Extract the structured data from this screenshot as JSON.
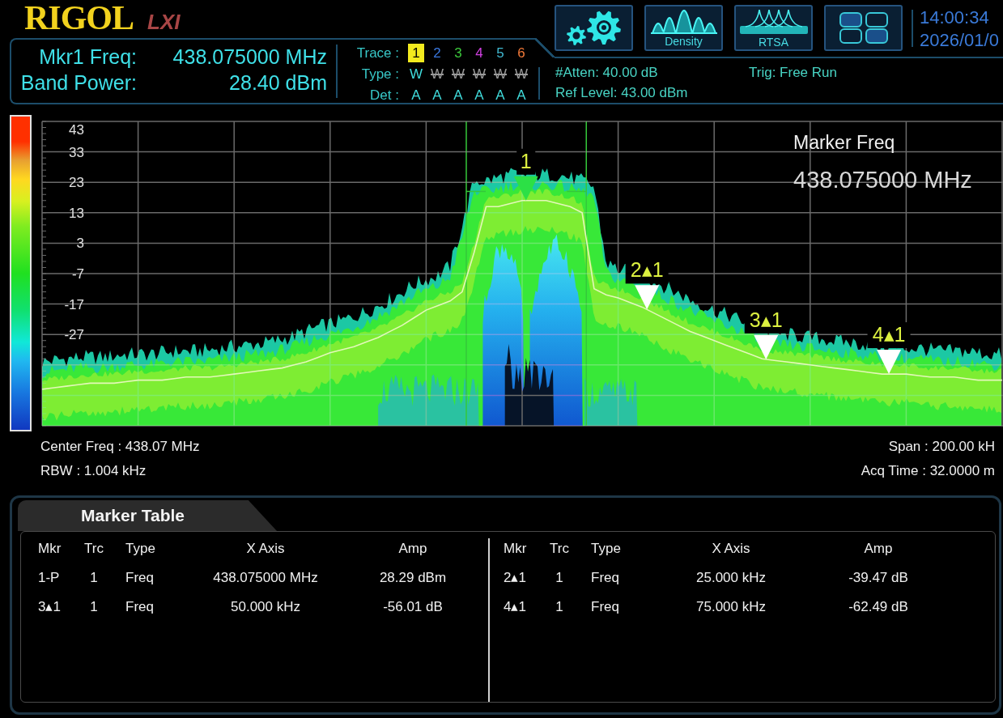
{
  "header": {
    "logo": {
      "brand": "RIGOL",
      "badge": "LXI"
    },
    "readouts": [
      {
        "label": "Mkr1 Freq:",
        "value": "438.075000 MHz"
      },
      {
        "label": "Band Power:",
        "value": "28.40 dBm"
      }
    ],
    "trace_table": {
      "trace_label": "Trace :",
      "type_label": "Type :",
      "det_label": "Det :",
      "traces": [
        {
          "number": "1",
          "color": "#f2ea1e",
          "selected": true,
          "type": "W",
          "on": true,
          "detector": "A"
        },
        {
          "number": "2",
          "color": "#3a78e0",
          "selected": false,
          "type": "W",
          "on": false,
          "detector": "A"
        },
        {
          "number": "3",
          "color": "#3cc83c",
          "selected": false,
          "type": "W",
          "on": false,
          "detector": "A"
        },
        {
          "number": "4",
          "color": "#d040e0",
          "selected": false,
          "type": "W",
          "on": false,
          "detector": "A"
        },
        {
          "number": "5",
          "color": "#40b8d0",
          "selected": false,
          "type": "W",
          "on": false,
          "detector": "A"
        },
        {
          "number": "6",
          "color": "#f07838",
          "selected": false,
          "type": "W",
          "on": false,
          "detector": "A"
        }
      ]
    },
    "mode_buttons": [
      {
        "kind": "settings"
      },
      {
        "kind": "density",
        "label": "Density"
      },
      {
        "kind": "rtsa",
        "label": "RTSA"
      },
      {
        "kind": "layout"
      }
    ],
    "clock": {
      "time": "14:00:34",
      "date": "2026/01/0"
    },
    "status": {
      "attenuation": "#Atten: 40.00 dB",
      "ref_level": "Ref Level: 43.00 dBm",
      "trigger": "Trig: Free Run"
    }
  },
  "spectrum": {
    "marker_readout": {
      "label": "Marker Freq",
      "value": "438.075000 MHz"
    },
    "markers": [
      {
        "label": "1",
        "color": "#2ce046"
      },
      {
        "label": "2▴1",
        "color": "#ffffff"
      },
      {
        "label": "3▴1",
        "color": "#ffffff"
      },
      {
        "label": "4▴1",
        "color": "#ffffff"
      }
    ],
    "chart_data": {
      "type": "line",
      "categories": [
        null,
        null,
        null,
        null,
        null,
        null,
        null,
        null,
        null,
        null,
        null,
        null,
        null,
        null,
        null,
        null,
        null,
        null,
        null,
        null,
        null,
        null,
        null,
        null,
        null,
        null,
        null,
        null,
        null,
        null,
        null,
        null,
        null,
        null,
        null,
        null,
        null,
        null,
        null,
        null,
        null,
        null,
        null,
        null,
        null,
        null,
        null,
        null,
        null,
        null,
        null,
        null,
        null,
        null,
        null,
        null,
        null,
        null,
        null,
        null,
        null,
        null,
        null,
        null,
        null,
        null,
        null,
        null,
        null,
        null,
        null,
        null,
        null,
        null,
        null,
        null,
        null,
        null,
        null,
        null,
        null
      ],
      "ylim": [
        -57,
        43
      ],
      "yticks": [
        43,
        33,
        23,
        13,
        3,
        -7,
        -17,
        -27
      ],
      "grid": true,
      "series": [
        {
          "color": "#eef8c8",
          "values": [
            -45,
            -44.5,
            -44,
            -43.5,
            -43,
            -43,
            -43,
            -42.5,
            -42,
            -42,
            -42,
            -41.5,
            -41,
            -41,
            -41,
            -40.5,
            -40,
            -39.5,
            -39,
            -38.5,
            -38,
            -37,
            -36,
            -34.5,
            -33,
            -32,
            -31,
            -29.5,
            -28,
            -26,
            -24,
            -21.5,
            -19,
            -17.5,
            -16,
            -13,
            0,
            15,
            15,
            16,
            17,
            17,
            17,
            16,
            15,
            13,
            -12,
            -14,
            -15,
            -16.5,
            -18,
            -20,
            -22,
            -24,
            -26,
            -27.5,
            -29,
            -30.5,
            -32,
            -33.5,
            -35,
            -35.5,
            -36,
            -36.5,
            -37,
            -37.5,
            -38,
            -38.5,
            -39,
            -39.5,
            -40,
            -40,
            -40,
            -40.5,
            -41,
            -41,
            -41,
            -41.5,
            -42,
            -42,
            -42
          ]
        }
      ]
    }
  },
  "sweep_info": {
    "center_freq": "Center Freq : 438.07 MHz",
    "rbw": "RBW : 1.004 kHz",
    "span": "Span : 200.00 kH",
    "acq_time": "Acq Time : 32.0000 m"
  },
  "marker_table": {
    "title": "Marker Table",
    "halves": [
      {
        "columns": [
          "Mkr",
          "Trc",
          "Type",
          "X Axis",
          "Amp"
        ],
        "rows": [
          [
            "1-P",
            "1",
            "Freq",
            "438.075000 MHz",
            "28.29 dBm"
          ],
          [
            "3▴1",
            "1",
            "Freq",
            "50.000 kHz",
            "-56.01 dB"
          ]
        ]
      },
      {
        "columns": [
          "Mkr",
          "Trc",
          "Type",
          "X Axis",
          "Amp"
        ],
        "rows": [
          [
            "2▴1",
            "1",
            "Freq",
            "25.000 kHz",
            "-39.47 dB"
          ],
          [
            "4▴1",
            "1",
            "Freq",
            "75.000 kHz",
            "-62.49 dB"
          ]
        ]
      }
    ]
  }
}
